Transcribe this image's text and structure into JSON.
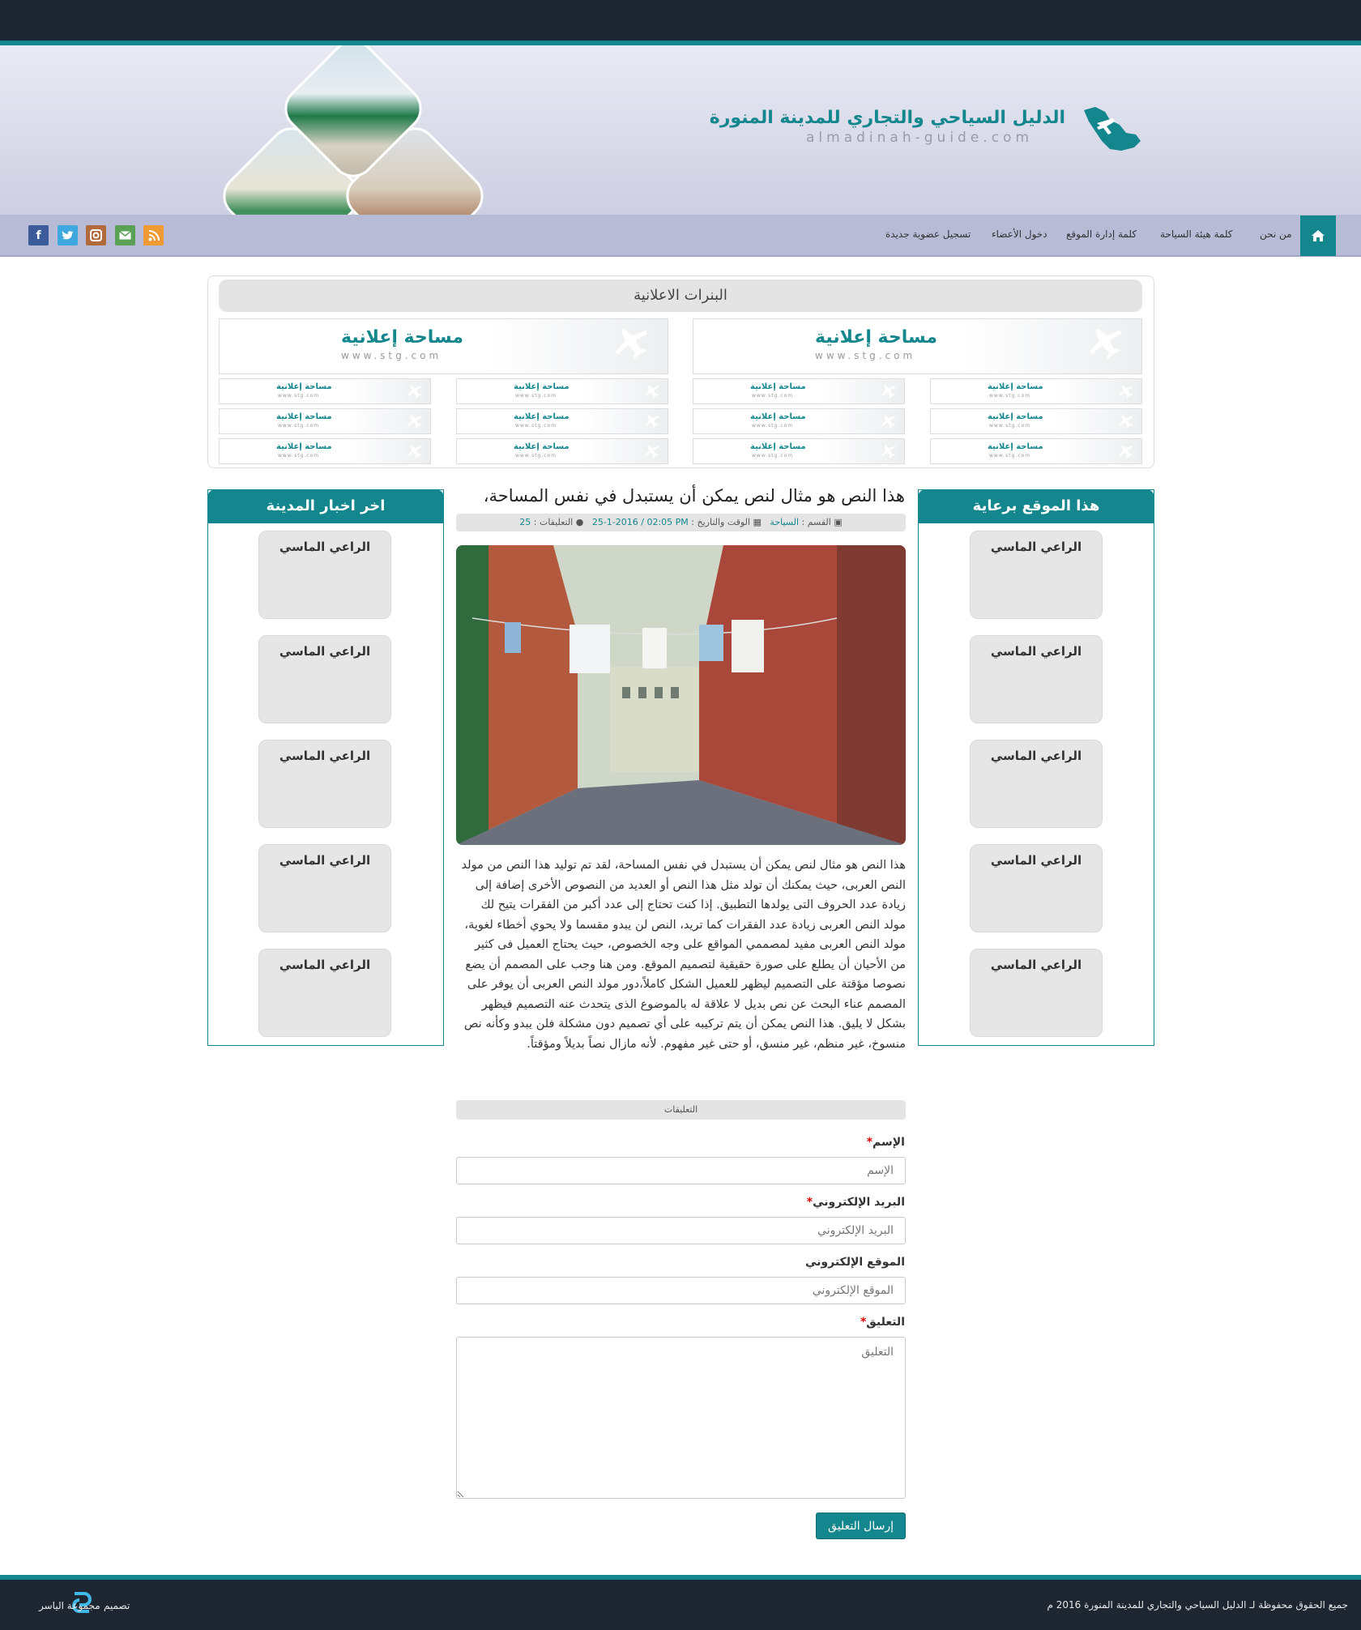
{
  "header": {
    "site_title": "الدليل السياحي والتجاري للمدينة المنورة",
    "site_domain": "almadinah-guide.com"
  },
  "nav": {
    "home_icon": "home-icon",
    "items": [
      "من نحن",
      "كلمة هيئة السياحة",
      "كلمة إدارة الموقع",
      "دخول الأعضاء",
      "تسجيل عضوية جديدة"
    ]
  },
  "social": [
    "facebook-icon",
    "twitter-icon",
    "instagram-icon",
    "email-icon",
    "rss-icon"
  ],
  "ads": {
    "title": "البنرات الاعلانية",
    "ad_label": "مساحة إعلانية",
    "ad_url": "www.stg.com"
  },
  "sponsor_box": {
    "title": "هذا الموقع برعاية",
    "cards": [
      "الراعي الماسي",
      "الراعي الماسي",
      "الراعي الماسي",
      "الراعي الماسي",
      "الراعي الماسي"
    ]
  },
  "news_box": {
    "title": "اخر اخبار المدينة",
    "cards": [
      "الراعي الماسي",
      "الراعي الماسي",
      "الراعي الماسي",
      "الراعي الماسي",
      "الراعي الماسي"
    ]
  },
  "article": {
    "title": "هذا النص هو مثال لنص يمكن أن يستبدل في نفس المساحة،",
    "meta": {
      "category_label": "القسم :",
      "category_value": "السياحة",
      "datetime_label": "الوقت والتاريخ :",
      "datetime_value": "25-1-2016 / 02:05 PM",
      "comments_label": "التعليقات :",
      "comments_value": "25"
    },
    "body": "هذا النص هو مثال لنص يمكن أن يستبدل في نفس المساحة، لقد تم توليد هذا النص من مولد النص العربى، حيث يمكنك أن تولد مثل هذا النص أو العديد من النصوص الأخرى إضافة إلى زيادة عدد الحروف التى يولدها التطبيق. إذا كنت تحتاج إلى عدد أكبر من الفقرات يتيح لك مولد النص العربى زيادة عدد الفقرات كما تريد، النص لن يبدو مقسما ولا يحوي أخطاء لغوية، مولد النص العربى مفيد لمصممي المواقع على وجه الخصوص، حيث يحتاج العميل فى كثير من الأحيان أن يطلع على صورة حقيقية لتصميم الموقع. ومن هنا وجب على المصمم أن يضع نصوصا مؤقتة على التصميم ليظهر للعميل الشكل كاملاً،دور مولد النص العربى أن يوفر على المصمم عناء البحث عن نص بديل لا علاقة له بالموضوع الذى يتحدث عنه التصميم فيظهر بشكل لا يليق. هذا النص يمكن أن يتم تركيبه على أي تصميم دون مشكلة فلن يبدو وكأنه نص منسوخ، غير منظم، غير منسق، أو حتى غير مفهوم. لأنه مازال نصاً بديلاً ومؤقتاً."
  },
  "comments_form": {
    "section_title": "التعليقات",
    "name_label": "الإسم",
    "name_placeholder": "الإسم",
    "email_label": "البريد الإلكتروني",
    "email_placeholder": "البريد الإلكتروني",
    "website_label": "الموقع الإلكتروني",
    "website_placeholder": "الموقع الإلكتروني",
    "comment_label": "التعليق",
    "comment_placeholder": "التعليق",
    "required_mark": "*",
    "submit_label": "إرسال التعليق"
  },
  "footer": {
    "copyright": "جميع الحقوق محفوظة لـ الدليل السياحي والتجاري للمدينة المنورة 2016 م",
    "design_label": "تصميم",
    "designer": "مجموعة الياسر"
  },
  "colors": {
    "accent": "#14868e",
    "dark": "#1e2631",
    "nav_bg": "#b8bbd5"
  }
}
